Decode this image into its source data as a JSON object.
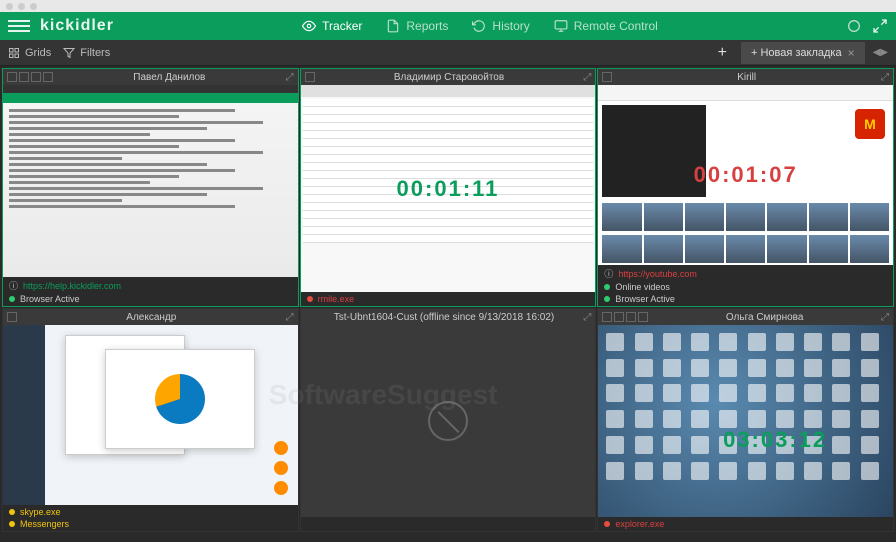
{
  "window": {
    "title": "Kickidler"
  },
  "logo": "kickidler",
  "topnav": {
    "tracker": "Tracker",
    "reports": "Reports",
    "history": "History",
    "remote": "Remote Control"
  },
  "toolbar": {
    "grids": "Grids",
    "filters": "Filters",
    "new_tab": "+ Новая закладка"
  },
  "tiles": [
    {
      "name": "Павел Данилов",
      "timer": "",
      "footer": [
        {
          "kind": "link",
          "text": "https://help.kickidler.com"
        },
        {
          "kind": "green",
          "text": "Browser Active"
        }
      ]
    },
    {
      "name": "Владимир Старовойтов",
      "timer": "00:01:11",
      "timer_color": "green",
      "footer": [
        {
          "kind": "red",
          "text": "rmile.exe"
        }
      ]
    },
    {
      "name": "Kirill",
      "timer": "00:01:07",
      "timer_color": "red",
      "footer": [
        {
          "kind": "redtext",
          "text": "https://youtube.com"
        },
        {
          "kind": "green",
          "text": "Online videos"
        },
        {
          "kind": "green",
          "text": "Browser Active"
        }
      ]
    },
    {
      "name": "Александр",
      "timer": "",
      "footer": [
        {
          "kind": "yellow",
          "text": "skype.exe"
        },
        {
          "kind": "yellow",
          "text": "Messengers"
        }
      ]
    },
    {
      "name": "Tst-Ubnt1604-Cust (offline since 9/13/2018 16:02)",
      "timer": "",
      "footer": []
    },
    {
      "name": "Ольга Смирнова",
      "timer": "03:03:12",
      "timer_color": "green",
      "footer": [
        {
          "kind": "red",
          "text": "explorer.exe"
        }
      ]
    }
  ],
  "watermark": "SoftwareSuggest"
}
